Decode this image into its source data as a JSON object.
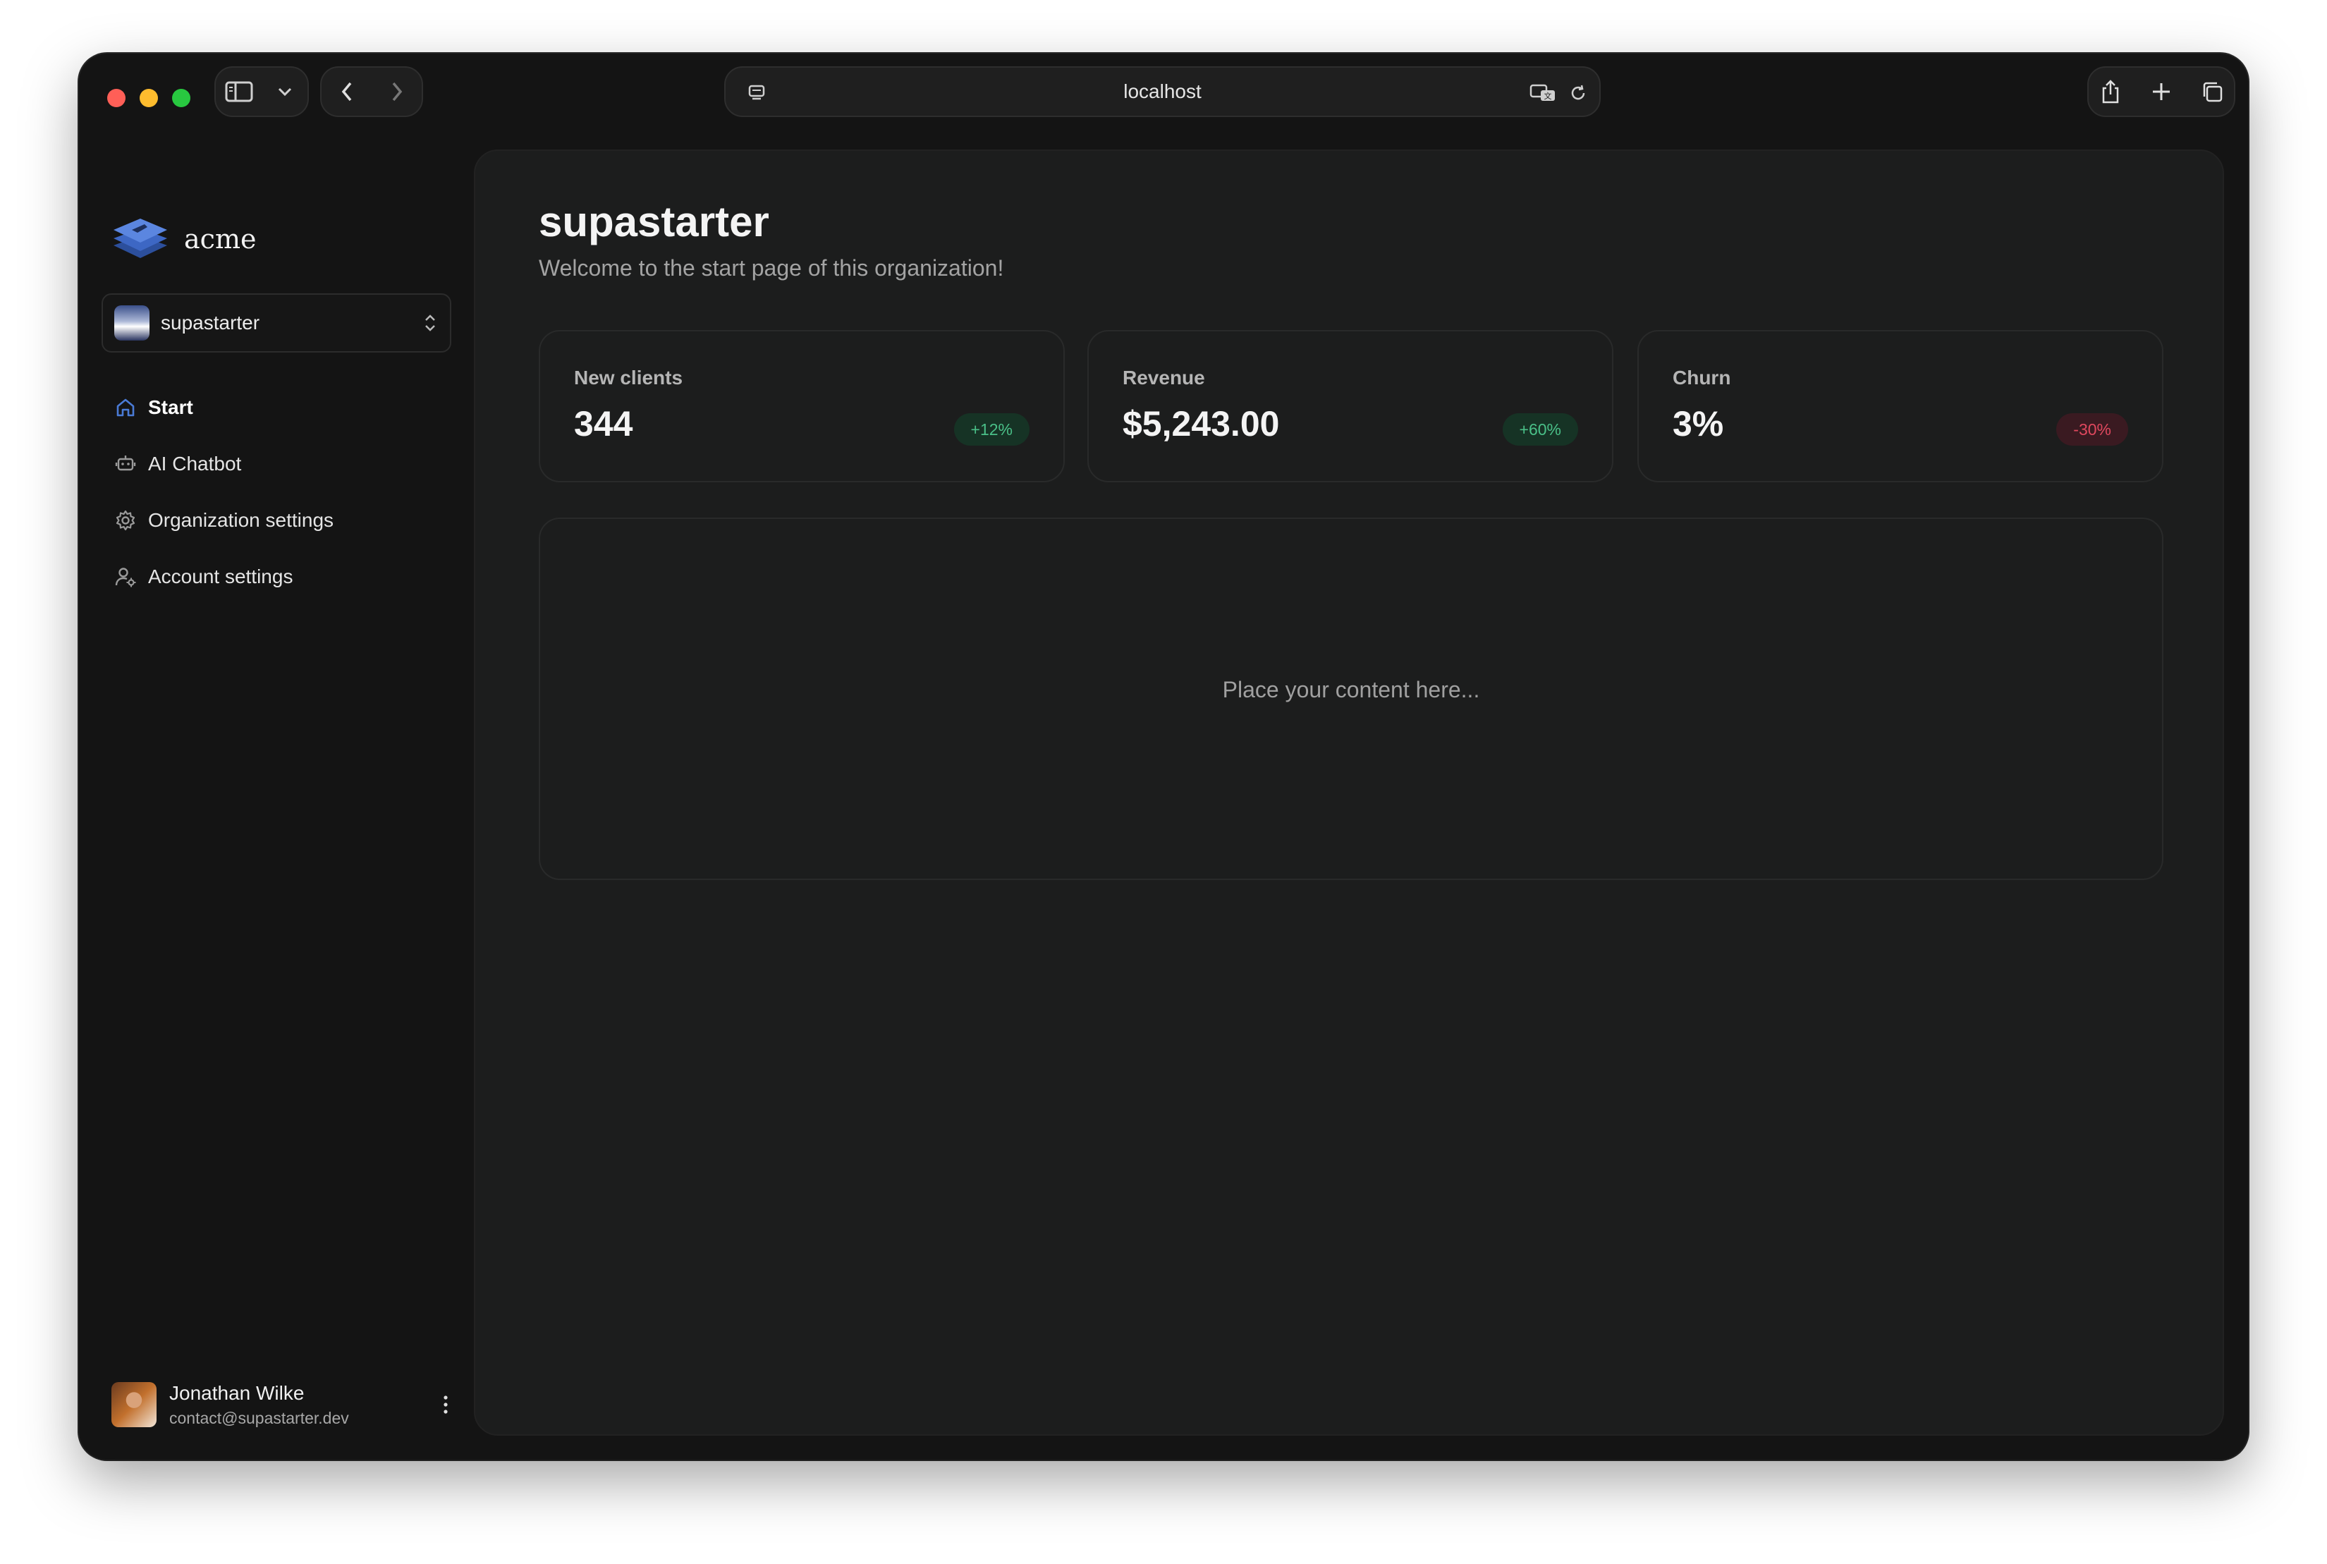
{
  "browser": {
    "url": "localhost"
  },
  "sidebar": {
    "brand": "acme",
    "organization": "supastarter",
    "items": [
      {
        "label": "Start",
        "icon": "home-icon",
        "active": true
      },
      {
        "label": "AI Chatbot",
        "icon": "chatbot-icon",
        "active": false
      },
      {
        "label": "Organization settings",
        "icon": "gear-icon",
        "active": false
      },
      {
        "label": "Account settings",
        "icon": "user-gear-icon",
        "active": false
      }
    ],
    "user": {
      "name": "Jonathan Wilke",
      "email": "contact@supastarter.dev"
    }
  },
  "main": {
    "title": "supastarter",
    "subtitle": "Welcome to the start page of this organization!",
    "stats": [
      {
        "label": "New clients",
        "value": "344",
        "badge": "+12%",
        "trend": "up"
      },
      {
        "label": "Revenue",
        "value": "$5,243.00",
        "badge": "+60%",
        "trend": "up"
      },
      {
        "label": "Churn",
        "value": "3%",
        "badge": "-30%",
        "trend": "down"
      }
    ],
    "placeholder": "Place your content here..."
  },
  "colors": {
    "accent": "#4a7bd6",
    "positive": "#4ac088",
    "negative": "#e0485e"
  }
}
